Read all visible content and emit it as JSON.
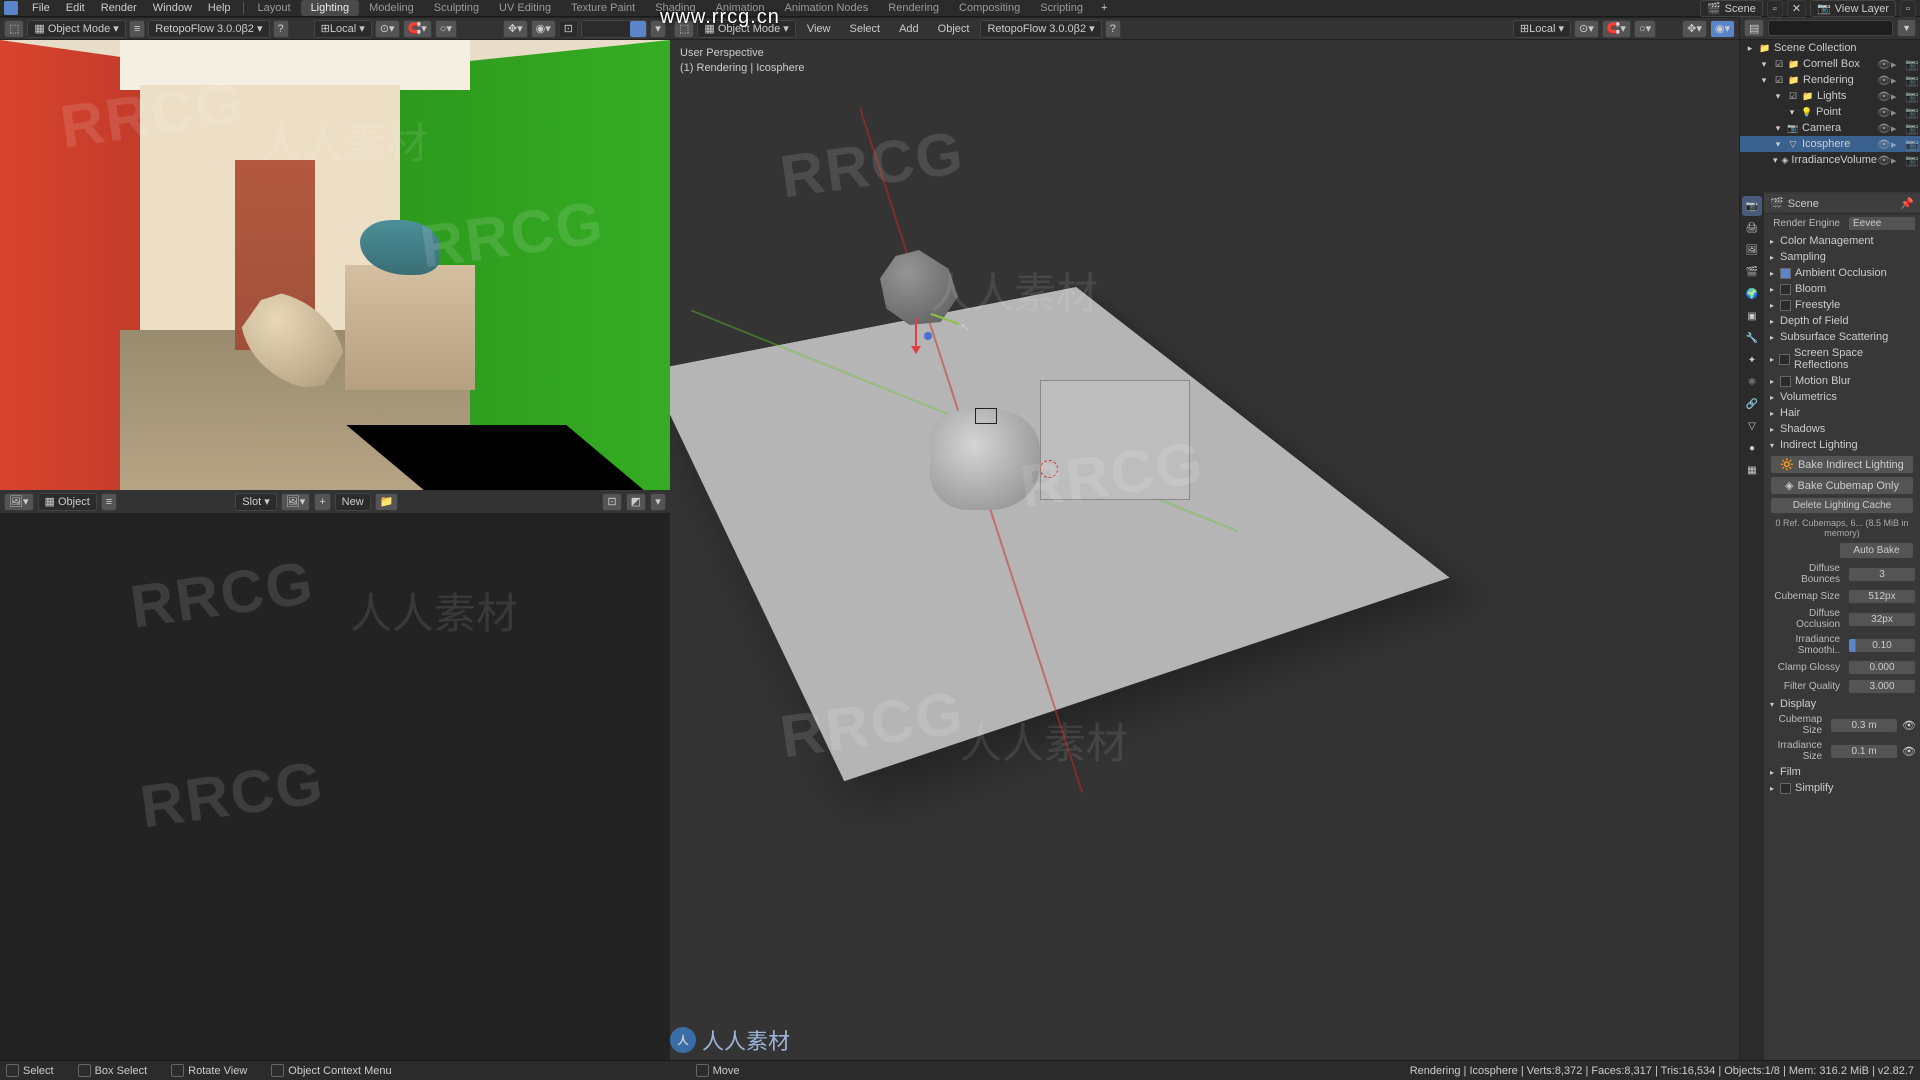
{
  "menu": {
    "file": "File",
    "edit": "Edit",
    "render": "Render",
    "window": "Window",
    "help": "Help"
  },
  "workspaces": [
    "Layout",
    "Lighting",
    "Modeling",
    "Sculpting",
    "UV Editing",
    "Texture Paint",
    "Shading",
    "Animation",
    "Animation Nodes",
    "Rendering",
    "Compositing",
    "Scripting"
  ],
  "workspace_active": "Lighting",
  "header_scene": "Scene",
  "header_viewlayer": "View Layer",
  "url_overlay": "www.rrcg.cn",
  "vp_left": {
    "mode": "Object Mode",
    "retopo": "RetopoFlow 3.0.0β2",
    "orient": "Local"
  },
  "vp_right": {
    "mode": "Object Mode",
    "menus": [
      "View",
      "Select",
      "Add",
      "Object"
    ],
    "retopo": "RetopoFlow 3.0.0β2",
    "orient": "Local",
    "hud_line1": "User Perspective",
    "hud_line2": "(1) Rendering | Icosphere"
  },
  "img_editor": {
    "mode": "Object",
    "slot": "Slot",
    "new": "New"
  },
  "outliner": {
    "root": "Scene Collection",
    "items": [
      {
        "name": "Cornell Box",
        "icon": "collection",
        "depth": 1
      },
      {
        "name": "Rendering",
        "icon": "collection",
        "depth": 1
      },
      {
        "name": "Lights",
        "icon": "collection",
        "depth": 2
      },
      {
        "name": "Point",
        "icon": "light",
        "depth": 3
      },
      {
        "name": "Camera",
        "icon": "camera",
        "depth": 2
      },
      {
        "name": "Icosphere",
        "icon": "mesh",
        "depth": 2,
        "selected": true
      },
      {
        "name": "IrradianceVolume",
        "icon": "lightprobe",
        "depth": 2
      }
    ]
  },
  "props": {
    "context": "Scene",
    "render_engine_label": "Render Engine",
    "render_engine": "Eevee",
    "panels": [
      {
        "label": "Color Management",
        "open": false
      },
      {
        "label": "Sampling",
        "open": false
      },
      {
        "label": "Ambient Occlusion",
        "open": false,
        "check": true
      },
      {
        "label": "Bloom",
        "open": false,
        "check": false
      },
      {
        "label": "Freestyle",
        "open": false,
        "check": false
      },
      {
        "label": "Depth of Field",
        "open": false
      },
      {
        "label": "Subsurface Scattering",
        "open": false
      },
      {
        "label": "Screen Space Reflections",
        "open": false,
        "check": false
      },
      {
        "label": "Motion Blur",
        "open": false,
        "check": false
      },
      {
        "label": "Volumetrics",
        "open": false
      },
      {
        "label": "Hair",
        "open": false
      },
      {
        "label": "Shadows",
        "open": false
      },
      {
        "label": "Indirect Lighting",
        "open": true
      }
    ],
    "indirect": {
      "bake": "Bake Indirect Lighting",
      "bake_cube": "Bake Cubemap Only",
      "delete": "Delete Lighting Cache",
      "info": "0 Ref. Cubemaps, 6... (8.5 MiB in memory)",
      "auto": "Auto Bake",
      "diffuse_bounces_label": "Diffuse Bounces",
      "diffuse_bounces": "3",
      "cubemap_size_label": "Cubemap Size",
      "cubemap_size": "512px",
      "diffuse_occl_label": "Diffuse Occlusion",
      "diffuse_occl": "32px",
      "irr_smooth_label": "Irradiance Smoothi..",
      "irr_smooth": "0.10",
      "clamp_label": "Clamp Glossy",
      "clamp": "0.000",
      "filter_label": "Filter Quality",
      "filter": "3.000"
    },
    "display": {
      "label": "Display",
      "cubemap_label": "Cubemap Size",
      "cubemap": "0.3 m",
      "irr_label": "Irradiance Size",
      "irr": "0.1 m"
    },
    "film": "Film",
    "simplify": "Simplify"
  },
  "status": {
    "select": "Select",
    "box": "Box Select",
    "rotate": "Rotate View",
    "ctx": "Object Context Menu",
    "move": "Move",
    "right": "Rendering | Icosphere | Verts:8,372 | Faces:8,317 | Tris:16,534 | Objects:1/8 | Mem: 316.2 MiB | v2.82.7"
  },
  "footer_brand": "人人素材"
}
